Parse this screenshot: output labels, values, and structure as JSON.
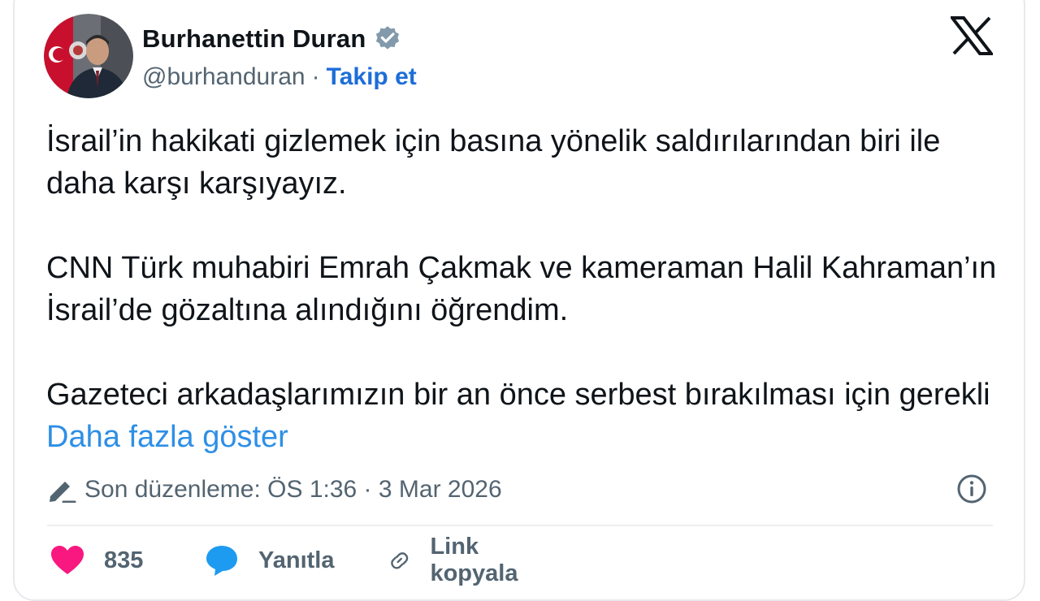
{
  "author": {
    "name": "Burhanettin Duran",
    "handle": "@burhanduran",
    "follow_label": "Takip et",
    "separator": "·"
  },
  "tweet": {
    "paragraphs": [
      "İsrail’in hakikati gizlemek için basına yönelik saldırılarından biri ile daha karşı karşıyayız.",
      "CNN Türk muhabiri Emrah Çakmak ve kameraman Halil Kahraman’ın İsrail’de gözaltına alındığını öğrendim."
    ],
    "last_paragraph_text": "Gazeteci arkadaşlarımızın bir an önce serbest bırakılması için gerekli",
    "show_more_label": "Daha fazla göster",
    "edited_text": "Son düzenleme: ÖS 1:36 · 3 Mar 2026"
  },
  "actions": {
    "likes": "835",
    "reply_label": "Yanıtla",
    "copy_link_label": "Link kopyala"
  },
  "icons": {
    "verified": "verified-badge-icon",
    "x_logo": "x-logo-icon",
    "edit": "pencil-icon",
    "info": "info-icon",
    "like": "heart-icon",
    "reply": "speech-bubble-icon",
    "link": "link-icon"
  },
  "colors": {
    "text": "#0f1419",
    "muted": "#536471",
    "follow": "#1d6ed8",
    "show_more": "#2e8fe6",
    "heart": "#f91880",
    "reply": "#1d9bf0"
  }
}
